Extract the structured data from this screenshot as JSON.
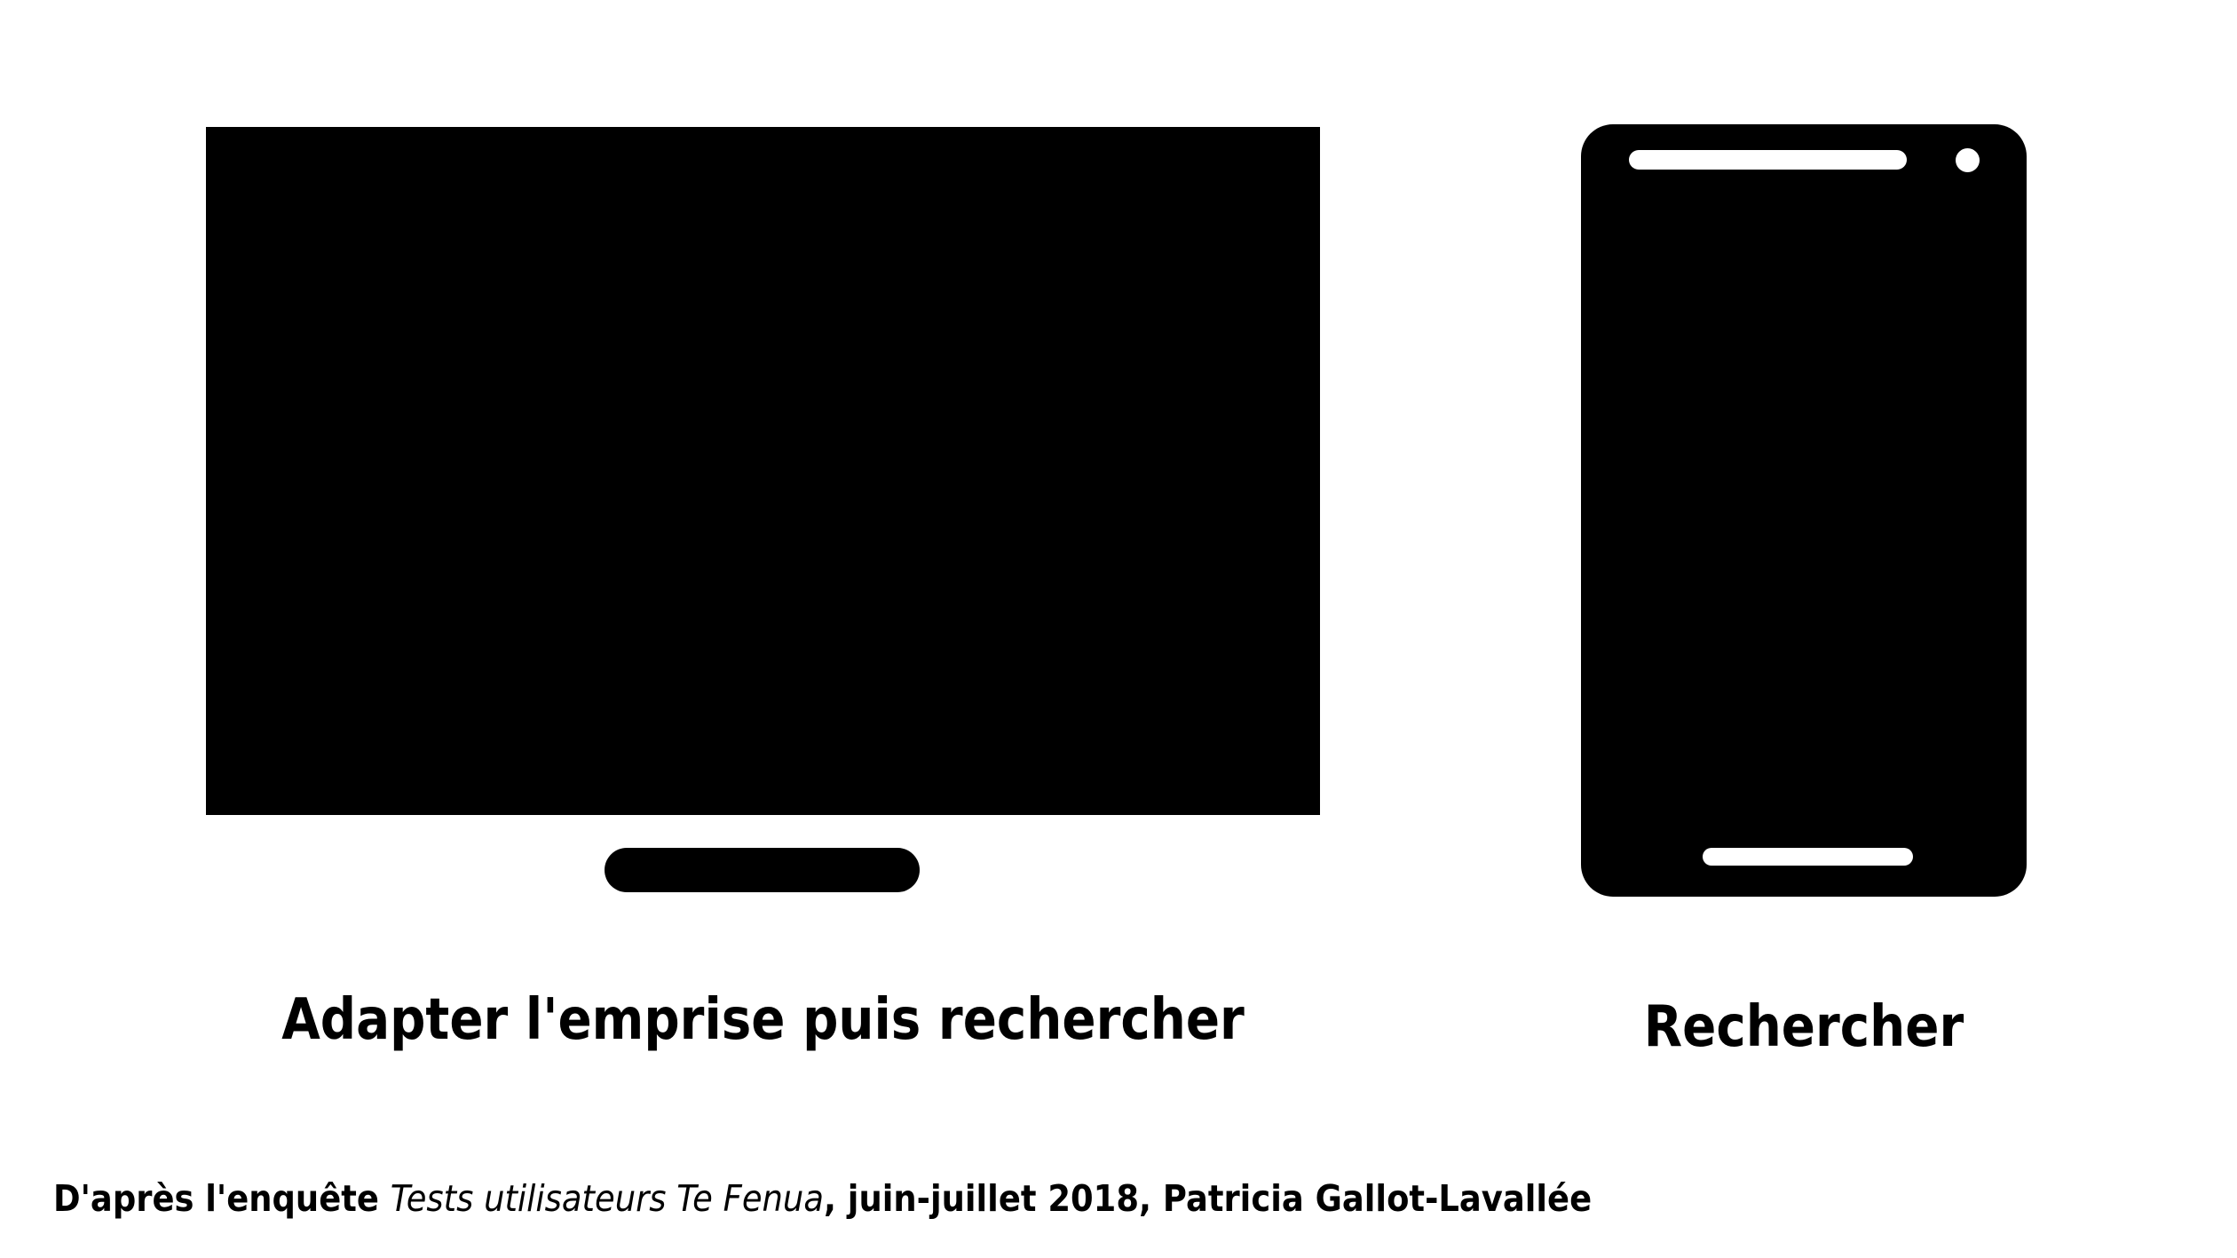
{
  "devices": {
    "desktop": {
      "icon": "desktop-monitor-icon",
      "label": "Adapter l'emprise puis rechercher"
    },
    "mobile": {
      "icon": "smartphone-icon",
      "label": "Rechercher"
    }
  },
  "source": {
    "prefix": "D'après l'enquête ",
    "title": "Tests utilisateurs Te Fenua",
    "suffix": ", juin-juillet 2018, Patricia Gallot-Lavallée"
  },
  "colors": {
    "foreground": "#000000",
    "background": "#ffffff"
  }
}
